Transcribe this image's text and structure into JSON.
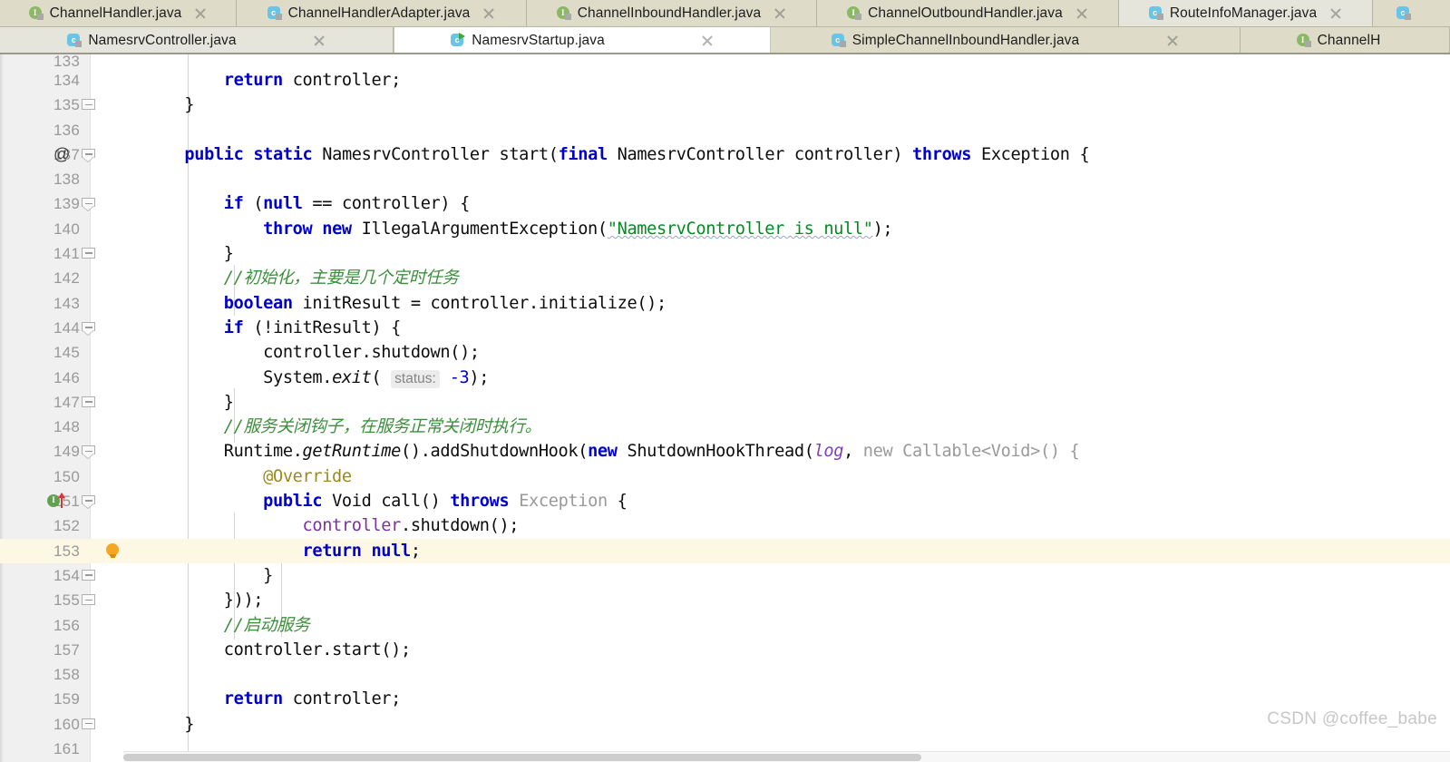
{
  "window": {
    "watermark": "CSDN @coffee_babe"
  },
  "tab_rows": [
    {
      "tabs": [
        {
          "label": "ChannelHandler.java",
          "icon": "java-interface-icon",
          "state": "inactive",
          "closable": true,
          "runnable": false
        },
        {
          "label": "ChannelHandlerAdapter.java",
          "icon": "java-class-icon",
          "state": "inactive",
          "closable": true,
          "runnable": false
        },
        {
          "label": "ChannelInboundHandler.java",
          "icon": "java-interface-icon",
          "state": "inactive",
          "closable": true,
          "runnable": false
        },
        {
          "label": "ChannelOutboundHandler.java",
          "icon": "java-interface-icon",
          "state": "inactive",
          "closable": true,
          "runnable": false
        },
        {
          "label": "RouteInfoManager.java",
          "icon": "java-class-icon",
          "state": "selected",
          "closable": true,
          "runnable": false
        },
        {
          "label": "",
          "icon": "java-class-icon",
          "state": "inactive",
          "closable": false,
          "runnable": false
        }
      ]
    },
    {
      "tabs": [
        {
          "label": "NamesrvController.java",
          "icon": "java-class-icon",
          "state": "inactive",
          "closable": true,
          "runnable": false
        },
        {
          "label": "NamesrvStartup.java",
          "icon": "java-class-icon",
          "state": "active",
          "closable": true,
          "runnable": true
        },
        {
          "label": "SimpleChannelInboundHandler.java",
          "icon": "java-class-icon",
          "state": "inactive",
          "closable": true,
          "runnable": false
        },
        {
          "label": "ChannelH",
          "icon": "java-interface-icon",
          "state": "inactive",
          "closable": false,
          "runnable": false
        }
      ]
    }
  ],
  "editor": {
    "file": "NamesrvStartup.java",
    "first_visible_line": 133,
    "last_visible_line": 161,
    "highlighted_line": 153,
    "gutter_marks": {
      "override_annotation_line": 137,
      "implemented_method_line": 151,
      "intention_bulb_line": 153
    },
    "lines": [
      {
        "n": 133,
        "text": ""
      },
      {
        "n": 134,
        "text": "        return controller;"
      },
      {
        "n": 135,
        "text": "    }"
      },
      {
        "n": 136,
        "text": ""
      },
      {
        "n": 137,
        "text": "    public static NamesrvController start(final NamesrvController controller) throws Exception {"
      },
      {
        "n": 138,
        "text": ""
      },
      {
        "n": 139,
        "text": "        if (null == controller) {"
      },
      {
        "n": 140,
        "text": "            throw new IllegalArgumentException(\"NamesrvController is null\");"
      },
      {
        "n": 141,
        "text": "        }"
      },
      {
        "n": 142,
        "text": "        //初始化，主要是几个定时任务"
      },
      {
        "n": 143,
        "text": "        boolean initResult = controller.initialize();"
      },
      {
        "n": 144,
        "text": "        if (!initResult) {"
      },
      {
        "n": 145,
        "text": "            controller.shutdown();"
      },
      {
        "n": 146,
        "text": "            System.exit( status: -3);"
      },
      {
        "n": 147,
        "text": "        }"
      },
      {
        "n": 148,
        "text": "        //服务关闭钩子，在服务正常关闭时执行。"
      },
      {
        "n": 149,
        "text": "        Runtime.getRuntime().addShutdownHook(new ShutdownHookThread(log, new Callable<Void>() {"
      },
      {
        "n": 150,
        "text": "            @Override"
      },
      {
        "n": 151,
        "text": "            public Void call() throws Exception {"
      },
      {
        "n": 152,
        "text": "                controller.shutdown();"
      },
      {
        "n": 153,
        "text": "                return null;"
      },
      {
        "n": 154,
        "text": "            }"
      },
      {
        "n": 155,
        "text": "        }));"
      },
      {
        "n": 156,
        "text": "        //启动服务"
      },
      {
        "n": 157,
        "text": "        controller.start();"
      },
      {
        "n": 158,
        "text": ""
      },
      {
        "n": 159,
        "text": "        return controller;"
      },
      {
        "n": 160,
        "text": "    }"
      },
      {
        "n": 161,
        "text": ""
      }
    ],
    "parameter_hints": [
      {
        "line": 146,
        "label": "status:"
      }
    ],
    "comments": [
      {
        "line": 142,
        "text": "//初始化，主要是几个定时任务"
      },
      {
        "line": 148,
        "text": "//服务关闭钩子，在服务正常关闭时执行。"
      },
      {
        "line": 156,
        "text": "//启动服务"
      }
    ],
    "strings": [
      {
        "line": 140,
        "text": "NamesrvController is null"
      }
    ],
    "colors": {
      "keyword": "#0000cc",
      "string": "#048a22",
      "comment": "#3d8f3d",
      "annotation": "#9a8b1a",
      "static_field": "#7d3fbf",
      "captured_var": "#7b2fa8",
      "grayed": "#9a9a9a",
      "line_highlight": "#fdf8e3",
      "gutter_bg": "#f0f0f0",
      "tabbar_bg": "#d2d1bc"
    }
  }
}
